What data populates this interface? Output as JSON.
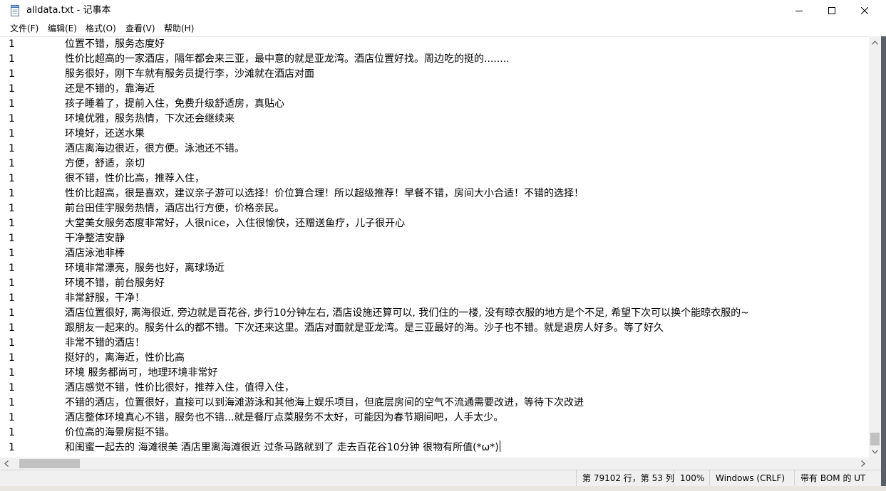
{
  "window": {
    "title": "alldata.txt - 记事本"
  },
  "menu": [
    "文件(F)",
    "编辑(E)",
    "格式(O)",
    "查看(V)",
    "帮助(H)"
  ],
  "lines": [
    {
      "label": "1",
      "text": "位置不错，服务态度好"
    },
    {
      "label": "1",
      "text": "性价比超高的一家酒店，隔年都会来三亚，最中意的就是亚龙湾。酒店位置好找。周边吃的挺的........"
    },
    {
      "label": "1",
      "text": "服务很好，刚下车就有服务员提行李，沙滩就在酒店对面"
    },
    {
      "label": "1",
      "text": "还是不错的，靠海近"
    },
    {
      "label": "1",
      "text": "孩子睡着了，提前入住，免费升级舒适房，真贴心"
    },
    {
      "label": "1",
      "text": "环境优雅，服务热情，下次还会继续来"
    },
    {
      "label": "1",
      "text": "环境好，还送水果"
    },
    {
      "label": "1",
      "text": "酒店离海边很近，很方便。泳池还不错。"
    },
    {
      "label": "1",
      "text": "方便，舒适，亲切"
    },
    {
      "label": "1",
      "text": "很不错，性价比高，推荐入住，"
    },
    {
      "label": "1",
      "text": "性价比超高，很是喜欢，建议亲子游可以选择！价位算合理！所以超级推荐！早餐不错，房间大小合适！不错的选择！"
    },
    {
      "label": "1",
      "text": "前台田佳宇服务热情，酒店出行方便，价格亲民。"
    },
    {
      "label": "1",
      "text": "大堂美女服务态度非常好，人很nice，入住很愉快，还赠送鱼疗，儿子很开心"
    },
    {
      "label": "1",
      "text": "干净整洁安静"
    },
    {
      "label": "1",
      "text": "酒店泳池非棒"
    },
    {
      "label": "1",
      "text": "环境非常漂亮，服务也好，离球场近"
    },
    {
      "label": "1",
      "text": "环境不错，前台服务好"
    },
    {
      "label": "1",
      "text": "非常舒服，干净！"
    },
    {
      "label": "1",
      "text": "酒店位置很好, 离海很近, 旁边就是百花谷, 步行10分钟左右, 酒店设施还算可以, 我们住的一楼, 没有晾衣服的地方是个不足, 希望下次可以换个能晾衣服的~"
    },
    {
      "label": "1",
      "text": "跟朋友一起来的。服务什么的都不错。下次还来这里。酒店对面就是亚龙湾。是三亚最好的海。沙子也不错。就是退房人好多。等了好久"
    },
    {
      "label": "1",
      "text": "非常不错的酒店！"
    },
    {
      "label": "1",
      "text": "挺好的，离海近，性价比高"
    },
    {
      "label": "1",
      "text": "环境 服务都尚可，地理环境非常好"
    },
    {
      "label": "1",
      "text": "酒店感觉不错，性价比很好，推荐入住，值得入住，"
    },
    {
      "label": "1",
      "text": "不错的酒店，位置很好，直接可以到海滩游泳和其他海上娱乐项目，但底层房间的空气不流通需要改进，等待下次改进"
    },
    {
      "label": "1",
      "text": "酒店整体环境真心不错，服务也不错...就是餐厅点菜服务不太好，可能因为春节期间吧，人手太少。"
    },
    {
      "label": "1",
      "text": "价位高的海景房挺不错。"
    },
    {
      "label": "1",
      "text": "和闺蜜一起去的 海滩很美 酒店里离海滩很近 过条马路就到了 走去百花谷10分钟 很物有所值(*ω*)"
    }
  ],
  "status": {
    "position": "第 79102 行，第 53 列",
    "zoom": "100%",
    "line_ending": "Windows (CRLF)",
    "encoding": "带有 BOM 的 UT"
  }
}
